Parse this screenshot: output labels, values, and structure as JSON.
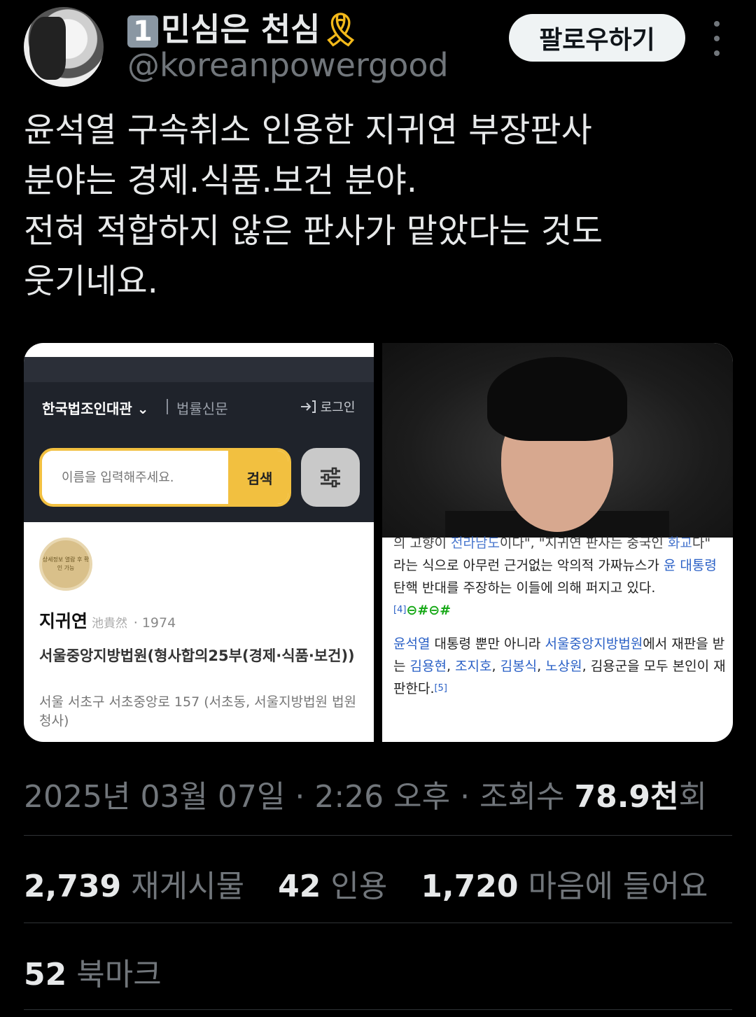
{
  "author": {
    "name_number": "1",
    "name": "민심은 천심",
    "name_emoji": "🎗",
    "handle": "@koreanpowergood"
  },
  "follow_label": "팔로우하기",
  "tweet_lines": [
    "윤석열 구속취소 인용한 지귀연 부장판사",
    "분야는 경제.식품.보건 분야.",
    "전혀 적합하지 않은 판사가 맡았다는 것도",
    "웃기네요."
  ],
  "left_image": {
    "brand": "한국법조인대관",
    "brand_chevron": "⌄",
    "news": "법률신문",
    "login": "로그인",
    "search_placeholder": "이름을 입력해주세요.",
    "search_button": "검색",
    "badge_text": "상세정보 열람 후 확인 가능",
    "name": "지귀연",
    "hanja": "池貴然",
    "year": "· 1974",
    "court": "서울중앙지방법원(형사합의25부(경제·식품·보건))",
    "address": "서울 서초구 서초중앙로 157 (서초동, 서울지방법원 법원청사)"
  },
  "right_image": {
    "line_partial_a": "의 고향이 ",
    "line_partial_link": "전라남도",
    "line_partial_b": "이다\", \"지귀연 판사는 중국인 ",
    "line_partial_link2": "화교",
    "line_partial_c": "다\"",
    "para1": "라는 식으로 아무런 근거없는 악의적 가짜뉴스가 ",
    "para1_link": "윤 대통령",
    "para1_rest": " 탄핵 반대를 주장하는 이들에 의해 퍼지고 있다.",
    "ref4": "[4]",
    "link_icons": "⊖#⊖#",
    "para2_link1": "윤석열",
    "para2_text1": " 대통령 뿐만 아니라 ",
    "para2_link2": "서울중앙지방법원",
    "para2_text2": "에서 재판을 받는 ",
    "para2_link3": "김용현",
    "para2_sep1": ", ",
    "para2_link4": "조지호",
    "para2_sep2": ", ",
    "para2_link5": "김봉식",
    "para2_sep3": ", ",
    "para2_link6": "노상원",
    "para2_text3": ", 김용군을 모두 본인이 재판한다.",
    "ref5": "[5]"
  },
  "meta": {
    "date": "2025년 03월 07일 · 2:26 오후 · 조회수 ",
    "views": "78.9천",
    "views_suffix": "회"
  },
  "stats": {
    "reposts_count": "2,739",
    "reposts_label": "재게시물",
    "quotes_count": "42",
    "quotes_label": "인용",
    "likes_count": "1,720",
    "likes_label": "마음에 들어요",
    "bookmarks_count": "52",
    "bookmarks_label": "북마크"
  },
  "colors": {
    "background": "#000000",
    "text": "#e7e9ea",
    "muted": "#71767b",
    "accent_yellow": "#f2c040"
  }
}
